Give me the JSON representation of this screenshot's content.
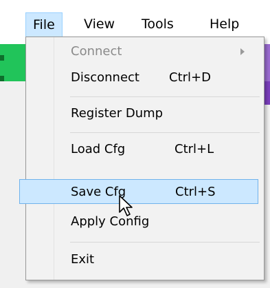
{
  "menubar": {
    "items": [
      {
        "label": "File",
        "active": true
      },
      {
        "label": "View"
      },
      {
        "label": "Tools"
      },
      {
        "label": "Help"
      }
    ]
  },
  "file_menu": {
    "items": [
      {
        "label": "Connect",
        "shortcut": "",
        "disabled": true,
        "submenu": true
      },
      {
        "label": "Disconnect",
        "shortcut": "Ctrl+D"
      },
      {
        "label": "Register Dump",
        "shortcut": ""
      },
      {
        "label": "Load Cfg",
        "shortcut": "Ctrl+L"
      },
      {
        "label": "Save Cfg",
        "shortcut": "Ctrl+S",
        "highlighted": true
      },
      {
        "label": "Apply Config",
        "shortcut": ""
      },
      {
        "label": "Exit",
        "shortcut": ""
      }
    ]
  },
  "colors": {
    "highlight": "#cce8ff",
    "highlight_border": "#6fb2ec",
    "disabled_text": "#8a8a8a",
    "left_strip": "#21c45a",
    "right_strip": "#9a6bd0"
  },
  "icons": {
    "submenu": "chevron-right-icon",
    "cursor": "mouse-pointer-icon"
  }
}
